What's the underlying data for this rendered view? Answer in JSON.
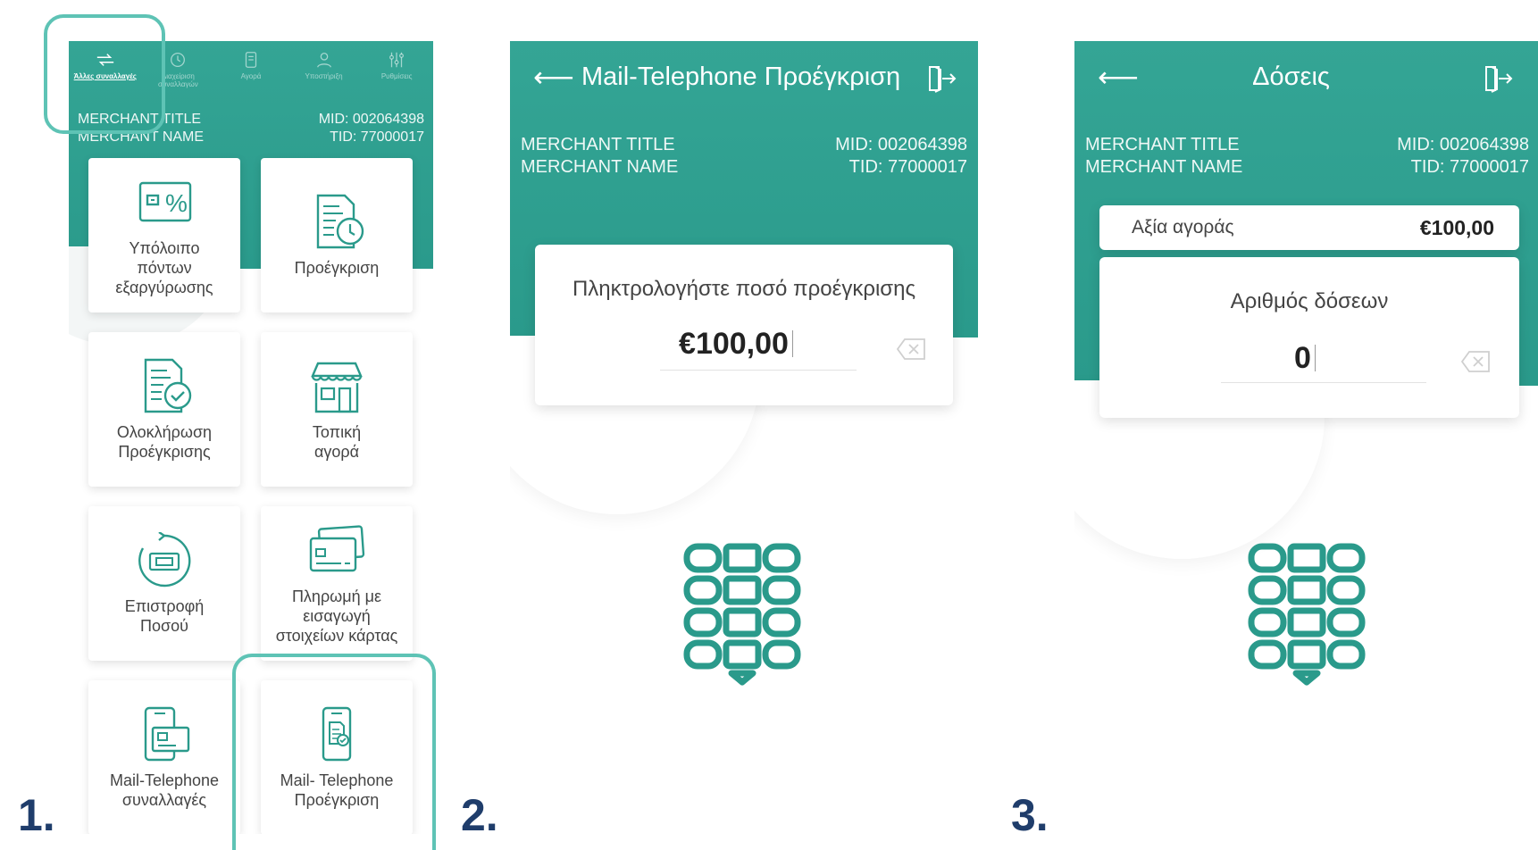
{
  "steps": [
    "1.",
    "2.",
    "3."
  ],
  "colors": {
    "teal": "#2a9a8b",
    "highlight": "#5ec3b5",
    "step_number": "#1f3d6b"
  },
  "screen1": {
    "nav": [
      {
        "label": "Άλλες συναλλαγές",
        "icon": "transfer-icon",
        "active": true
      },
      {
        "label": "Διαχείριση συναλλαγών",
        "icon": "manage-icon",
        "active": false
      },
      {
        "label": "Αγορά",
        "icon": "purchase-icon",
        "active": false
      },
      {
        "label": "Υποστήριξη",
        "icon": "support-icon",
        "active": false
      },
      {
        "label": "Ρυθμίσεις",
        "icon": "settings-icon",
        "active": false
      }
    ],
    "merchant_title": "MERCHANT TITLE",
    "merchant_name": "MERCHANT NAME",
    "mid": "MID: 002064398",
    "tid": "TID: 77000017",
    "tiles": [
      {
        "label": "Υπόλοιπο\nπόντων\nεξαργύρωσης",
        "icon": "points-balance-icon"
      },
      {
        "label": "Προέγκριση",
        "icon": "preauthorization-icon"
      },
      {
        "label": "Ολοκλήρωση\nΠροέγκρισης",
        "icon": "preauthorization-complete-icon"
      },
      {
        "label": "Τοπική\nαγορά",
        "icon": "local-store-icon"
      },
      {
        "label": "Επιστροφή\nΠοσού",
        "icon": "refund-icon"
      },
      {
        "label": "Πληρωμή με\nεισαγωγή\nστοιχείων κάρτας",
        "icon": "card-entry-icon"
      },
      {
        "label": "Mail-Telephone\nσυναλλαγές",
        "icon": "mail-telephone-icon"
      },
      {
        "label": "Mail- Telephone\nΠροέγκριση",
        "icon": "mail-telephone-preauth-icon"
      }
    ]
  },
  "screen2": {
    "title": "Mail-Telephone Προέγκριση",
    "merchant_title": "MERCHANT TITLE",
    "merchant_name": "MERCHANT NAME",
    "mid": "MID: 002064398",
    "tid": "TID: 77000017",
    "prompt": "Πληκτρολογήστε ποσό προέγκρισης",
    "amount": "€100,00"
  },
  "screen3": {
    "title": "Δόσεις",
    "merchant_title": "MERCHANT TITLE",
    "merchant_name": "MERCHANT NAME",
    "mid": "MID: 002064398",
    "tid": "TID: 77000017",
    "purchase_label": "Αξία αγοράς",
    "purchase_value": "€100,00",
    "installments_label": "Αριθμός δόσεων",
    "installments_value": "0"
  }
}
